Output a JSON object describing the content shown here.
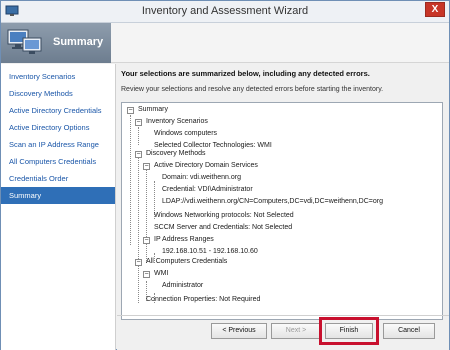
{
  "window": {
    "title": "Inventory and Assessment Wizard",
    "close_label": "X"
  },
  "header": {
    "page_title": "Summary"
  },
  "sidebar": {
    "items": [
      {
        "label": "Inventory Scenarios"
      },
      {
        "label": "Discovery Methods"
      },
      {
        "label": "Active Directory Credentials"
      },
      {
        "label": "Active Directory Options"
      },
      {
        "label": "Scan an IP Address Range"
      },
      {
        "label": "All Computers Credentials"
      },
      {
        "label": "Credentials Order"
      },
      {
        "label": "Summary",
        "active": true
      }
    ]
  },
  "main": {
    "heading": "Your selections are summarized below, including any detected errors.",
    "subtext": "Review your selections and resolve any detected errors before starting the inventory.",
    "tree": [
      {
        "text": "Summary"
      },
      {
        "text": "Inventory Scenarios"
      },
      {
        "text": "Windows computers"
      },
      {
        "text": "Selected Collector Technologies: WMI"
      },
      {
        "text": "Discovery Methods"
      },
      {
        "text": "Active Directory Domain Services"
      },
      {
        "text": "Domain: vdi.weithenn.org"
      },
      {
        "text": "Credential: VDI\\Administrator"
      },
      {
        "text": "LDAP://vdi.weithenn.org/CN=Computers,DC=vdi,DC=weithenn,DC=org"
      },
      {
        "text": "Windows Networking protocols: Not Selected"
      },
      {
        "text": "SCCM Server and Credentials: Not Selected"
      },
      {
        "text": "IP Address Ranges"
      },
      {
        "text": "192.168.10.51 - 192.168.10.60"
      },
      {
        "text": "All Computers Credentials"
      },
      {
        "text": "WMI"
      },
      {
        "text": "Administrator"
      },
      {
        "text": "Connection Properties: Not Required"
      }
    ]
  },
  "footer": {
    "previous_label": "< Previous",
    "next_label": "Next >",
    "finish_label": "Finish",
    "cancel_label": "Cancel"
  },
  "colors": {
    "accent_highlight": "#c8102e",
    "selected_nav": "#2f6fb7",
    "link_text": "#1a56a8"
  },
  "icons": {
    "app": "computer-icon",
    "header": "computers-icon",
    "close": "close-icon"
  }
}
